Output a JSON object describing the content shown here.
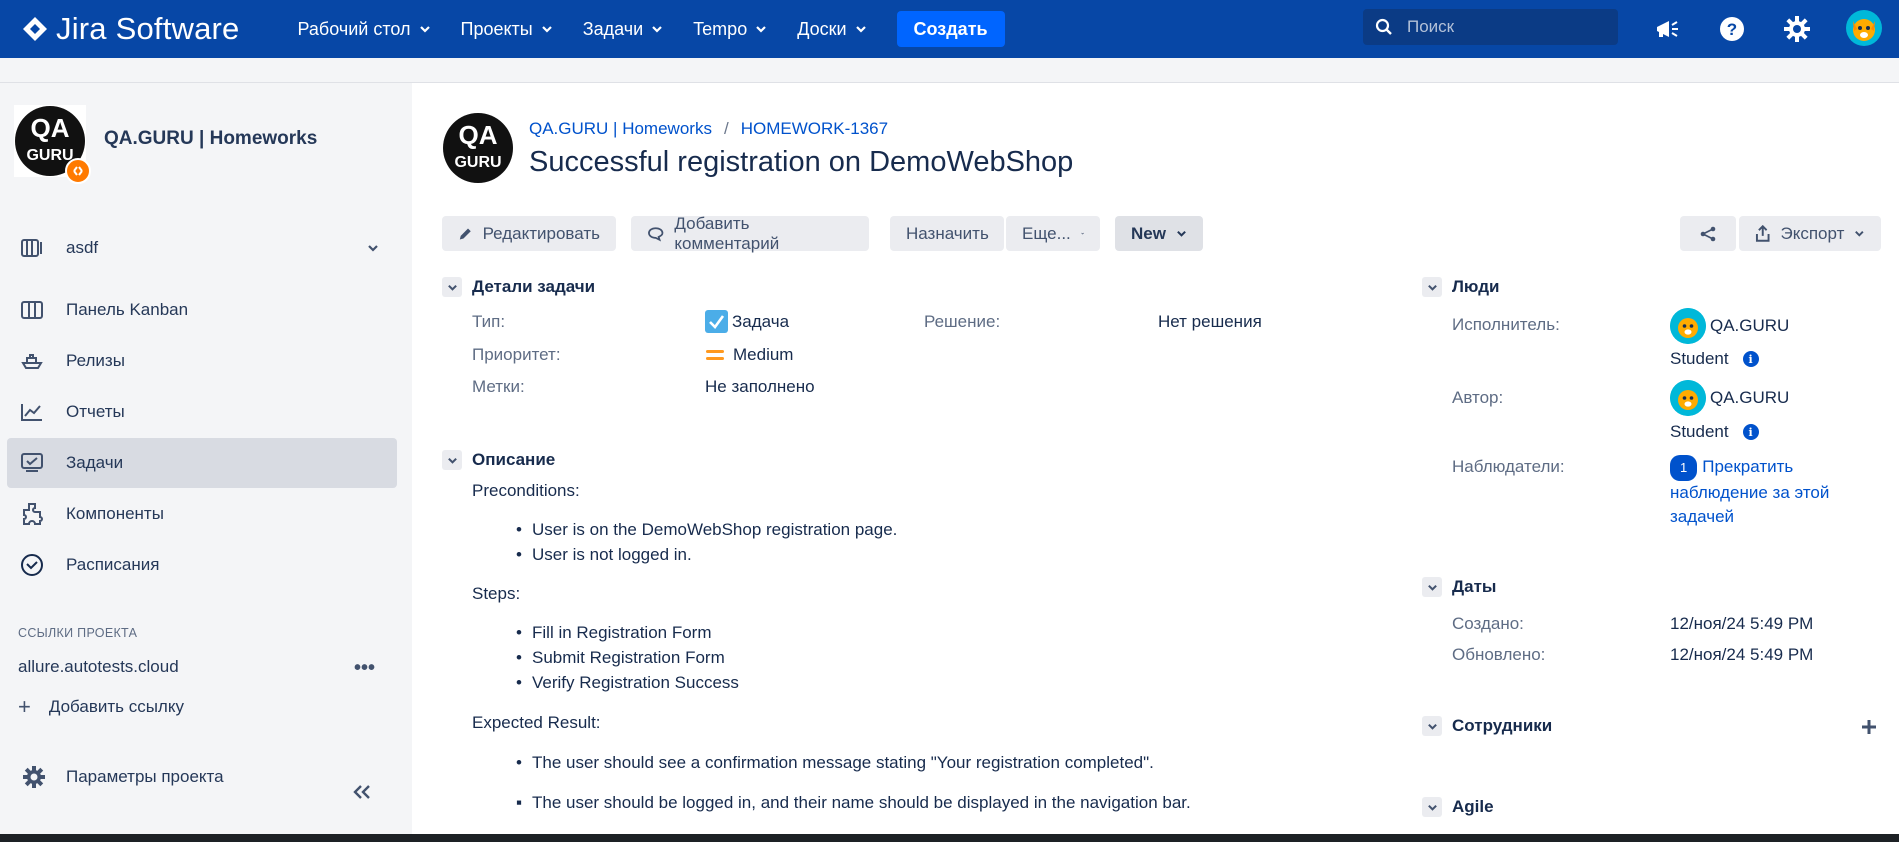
{
  "app": {
    "logo_text": "Jira Software"
  },
  "topnav": {
    "menu": [
      "Рабочий стол",
      "Проекты",
      "Задачи",
      "Tempo",
      "Доски"
    ],
    "create_label": "Создать",
    "search_placeholder": "Поиск"
  },
  "sidebar": {
    "project_name": "QA.GURU | Homeworks",
    "board_selector": "asdf",
    "items": [
      {
        "label": "Панель Kanban",
        "icon": "kanban-board-icon"
      },
      {
        "label": "Релизы",
        "icon": "ship-icon"
      },
      {
        "label": "Отчеты",
        "icon": "chart-icon"
      },
      {
        "label": "Задачи",
        "icon": "issues-icon",
        "active": true
      },
      {
        "label": "Компоненты",
        "icon": "puzzle-icon"
      },
      {
        "label": "Расписания",
        "icon": "clock-icon"
      }
    ],
    "links_section_title": "ССЫЛКИ ПРОЕКТА",
    "link": "allure.autotests.cloud",
    "add_link_label": "Добавить ссылку",
    "settings_label": "Параметры проекта"
  },
  "issue": {
    "breadcrumb_project": "QA.GURU | Homeworks",
    "breadcrumb_sep": "/",
    "breadcrumb_key": "HOMEWORK-1367",
    "title": "Successful registration on DemoWebShop",
    "toolbar": {
      "edit": "Редактировать",
      "comment": "Добавить комментарий",
      "assign": "Назначить",
      "more": "Еще...",
      "status": "New",
      "export": "Экспорт"
    },
    "details": {
      "heading": "Детали задачи",
      "type_label": "Тип:",
      "type_value": "Задача",
      "priority_label": "Приоритет:",
      "priority_value": "Medium",
      "labels_label": "Метки:",
      "labels_value": "Не заполнено",
      "resolution_label": "Решение:",
      "resolution_value": "Нет решения"
    },
    "description": {
      "heading": "Описание",
      "preconditions_title": "Preconditions:",
      "preconditions": [
        "User is on the DemoWebShop registration page.",
        "User is not logged in."
      ],
      "steps_title": "Steps:",
      "steps": [
        "Fill in Registration Form",
        "Submit Registration Form",
        "Verify Registration Success"
      ],
      "expected_title": "Expected Result:",
      "expected": [
        "The user should see a confirmation message stating \"Your registration completed\".",
        "The user should be logged in, and their name should be displayed in the navigation bar."
      ]
    },
    "people": {
      "heading": "Люди",
      "assignee_label": "Исполнитель:",
      "assignee_line1": "QA.GURU",
      "assignee_line2": "Student",
      "reporter_label": "Автор:",
      "reporter_line1": "QA.GURU",
      "reporter_line2": "Student",
      "watchers_label": "Наблюдатели:",
      "watchers_count": "1",
      "watchers_action": "Прекратить наблюдение за этой задачей"
    },
    "dates": {
      "heading": "Даты",
      "created_label": "Создано:",
      "created_value": "12/ноя/24 5:49 PM",
      "updated_label": "Обновлено:",
      "updated_value": "12/ноя/24 5:49 PM"
    },
    "employees_heading": "Сотрудники",
    "agile_heading": "Agile"
  },
  "colors": {
    "nav_bg": "#0747a6",
    "create_btn": "#0065ff",
    "link": "#0052cc",
    "sidebar_bg": "#f4f5f7",
    "priority": "#ff991f"
  }
}
